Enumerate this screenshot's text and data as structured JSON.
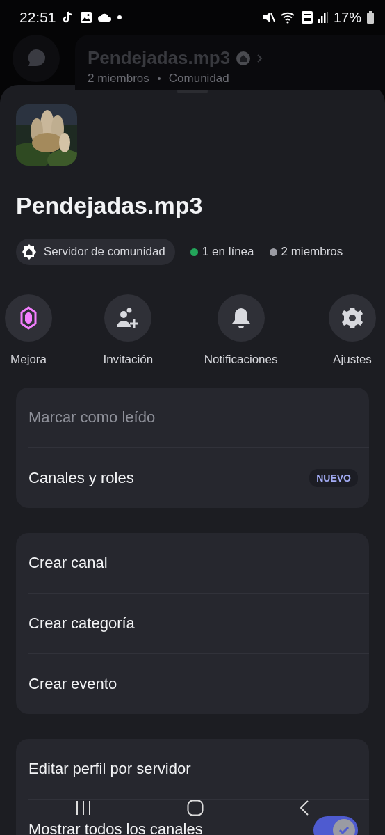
{
  "status_bar": {
    "time": "22:51",
    "battery": "17%"
  },
  "background_header": {
    "title": "Pendejadas.mp3",
    "members": "2 miembros",
    "type": "Comunidad"
  },
  "server": {
    "name": "Pendejadas.mp3",
    "community_chip": "Servidor de comunidad",
    "stats": [
      {
        "label": "1 en línea",
        "color": "#23a55a"
      },
      {
        "label": "2 miembros",
        "color": "#9a9ba3"
      }
    ]
  },
  "actions": [
    {
      "kind": "boost",
      "label": "Mejora"
    },
    {
      "kind": "invite",
      "label": "Invitación"
    },
    {
      "kind": "notifications",
      "label": "Notificaciones"
    },
    {
      "kind": "settings",
      "label": "Ajustes"
    }
  ],
  "menu_groups": [
    {
      "items": [
        {
          "kind": "plain",
          "label": "Marcar como leído",
          "disabled": true
        },
        {
          "kind": "badge",
          "label": "Canales y roles",
          "disabled": false,
          "badge": "NUEVO"
        }
      ]
    },
    {
      "items": [
        {
          "kind": "plain",
          "label": "Crear canal",
          "disabled": false
        },
        {
          "kind": "plain",
          "label": "Crear categoría",
          "disabled": false
        },
        {
          "kind": "plain",
          "label": "Crear evento",
          "disabled": false
        }
      ]
    },
    {
      "items": [
        {
          "kind": "plain",
          "label": "Editar perfil por servidor",
          "disabled": false
        },
        {
          "kind": "toggle",
          "label": "Mostrar todos los canales",
          "disabled": false,
          "on": true
        }
      ]
    }
  ]
}
